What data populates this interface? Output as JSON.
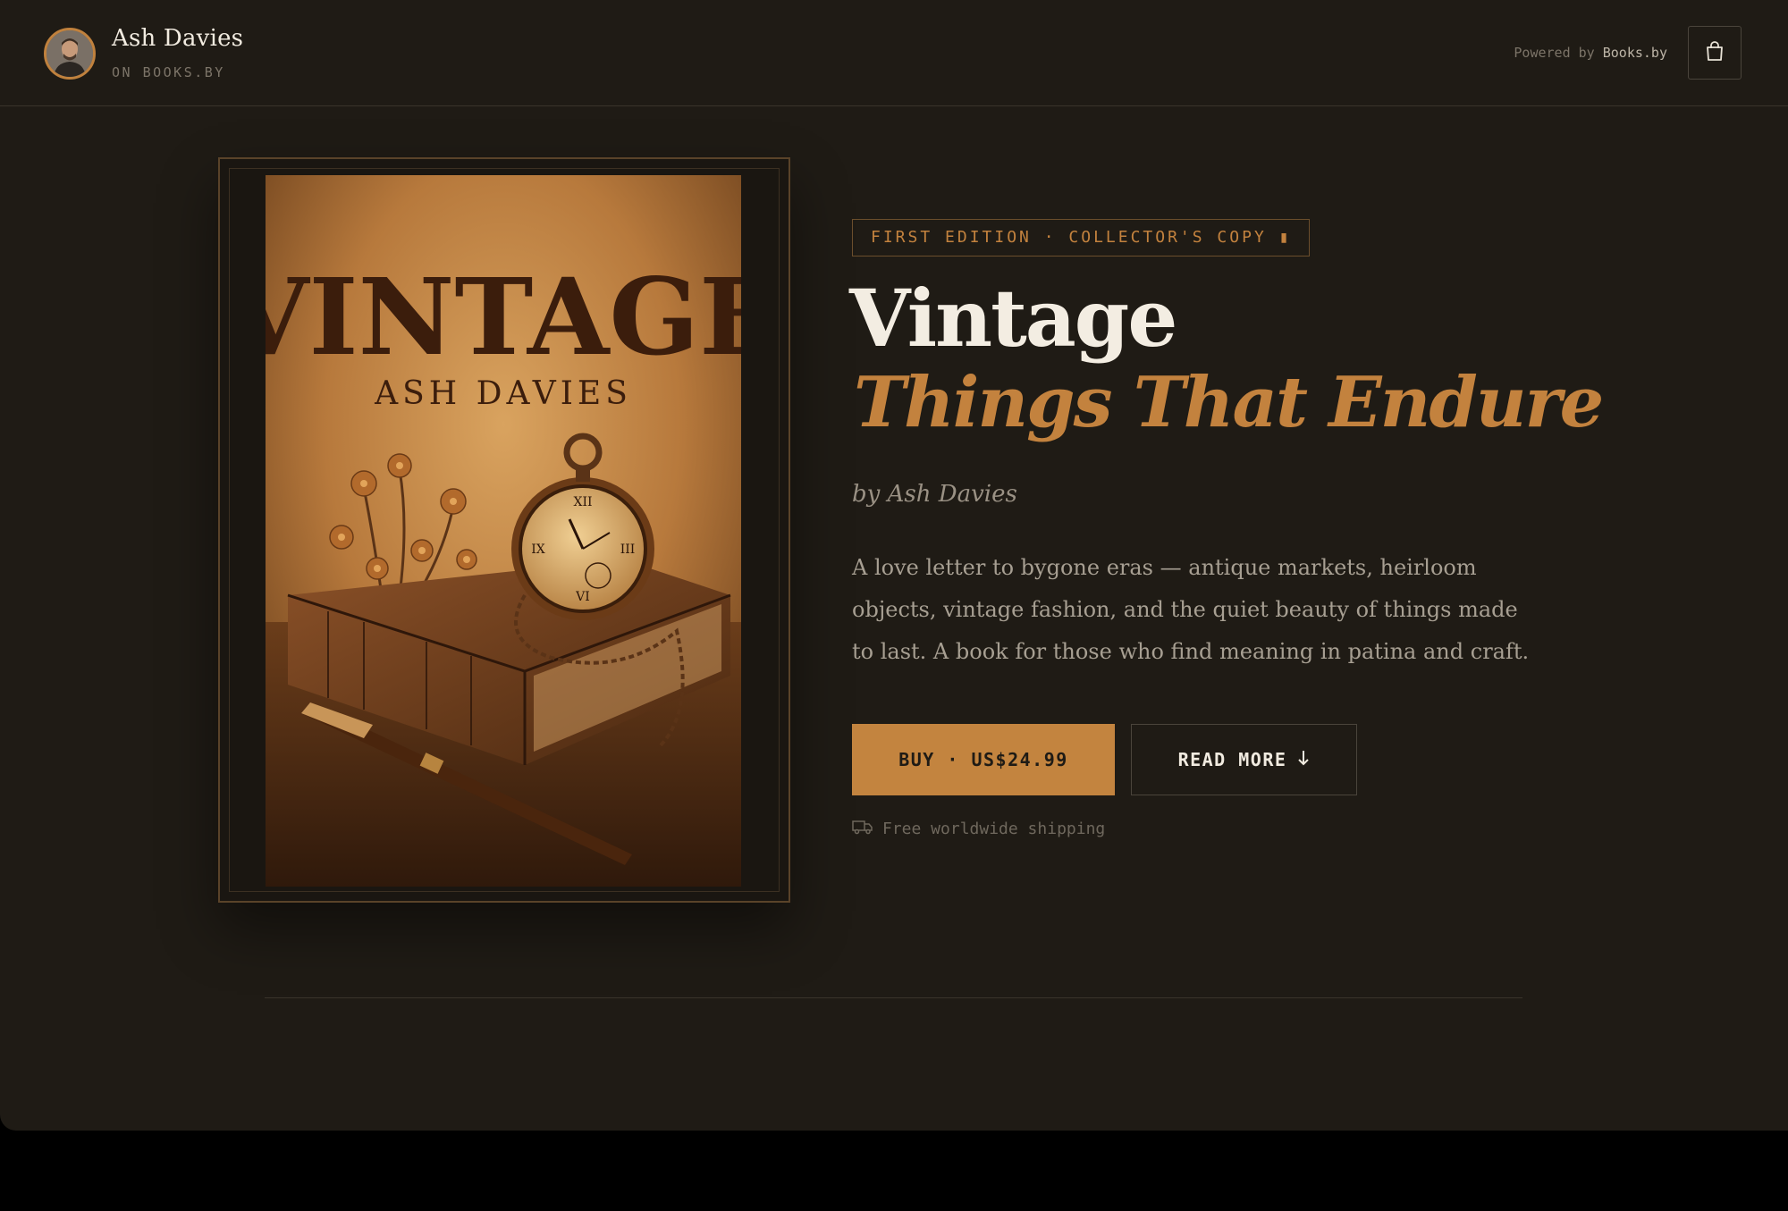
{
  "header": {
    "author_name": "Ash Davies",
    "author_sub": "ON BOOKS.BY",
    "powered_prefix": "Powered by",
    "powered_brand": "Books.by",
    "cart_icon": "shopping-bag-icon"
  },
  "cover": {
    "title": "VINTAGE",
    "author": "ASH DAVIES"
  },
  "book": {
    "edition_badge": "FIRST EDITION · COLLECTOR'S COPY ▮",
    "title_main": "Vintage",
    "title_sub": "Things That Endure",
    "byline": "by Ash Davies",
    "description": "A love letter to bygone eras — antique markets, heirloom objects, vintage fashion, and the quiet beauty of things made to last. A book for those who find meaning in patina and craft."
  },
  "actions": {
    "buy_label": "BUY · US$24.99",
    "read_more_label": "READ MORE",
    "read_more_icon": "arrow-down-icon"
  },
  "shipping": {
    "icon": "truck-icon",
    "text": "Free worldwide shipping"
  },
  "colors": {
    "background": "#1f1b15",
    "accent": "#c3843f",
    "title": "#f3ede2",
    "body_text": "#a79f92"
  }
}
